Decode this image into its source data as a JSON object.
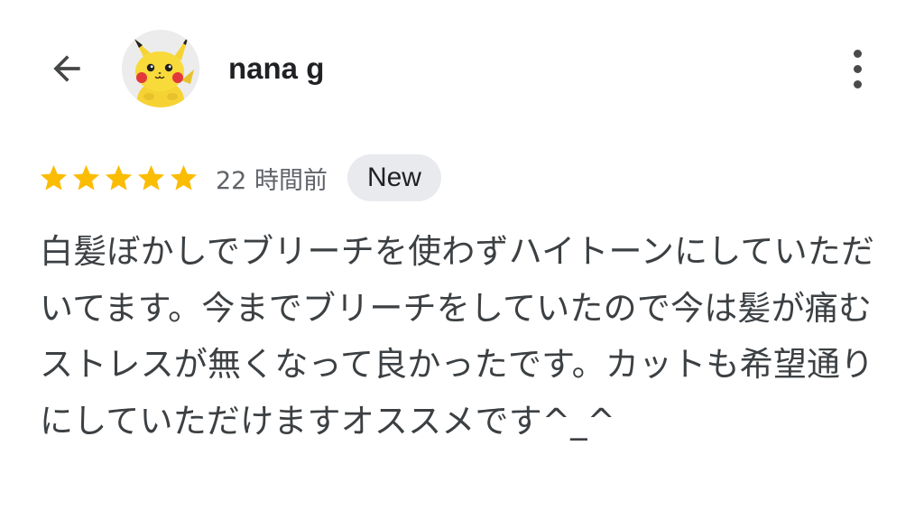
{
  "header": {
    "user_name": "nana g"
  },
  "review": {
    "rating": 5,
    "rating_max": 5,
    "time_label": "22 時間前",
    "badge": "New",
    "text": "白髪ぼかしでブリーチを使わずハイトーンにしていただいてます。今までブリーチをしていたので今は髪が痛むストレスが無くなって良かったです。カットも希望通りにしていただけますオススメです^_^"
  },
  "colors": {
    "star": "#FBBC04",
    "badge_bg": "#E8EAED",
    "text": "#3C4043",
    "secondary": "#5F6368"
  },
  "icons": {
    "back": "arrow-back-icon",
    "more": "more-vertical-icon",
    "star": "star-icon"
  }
}
